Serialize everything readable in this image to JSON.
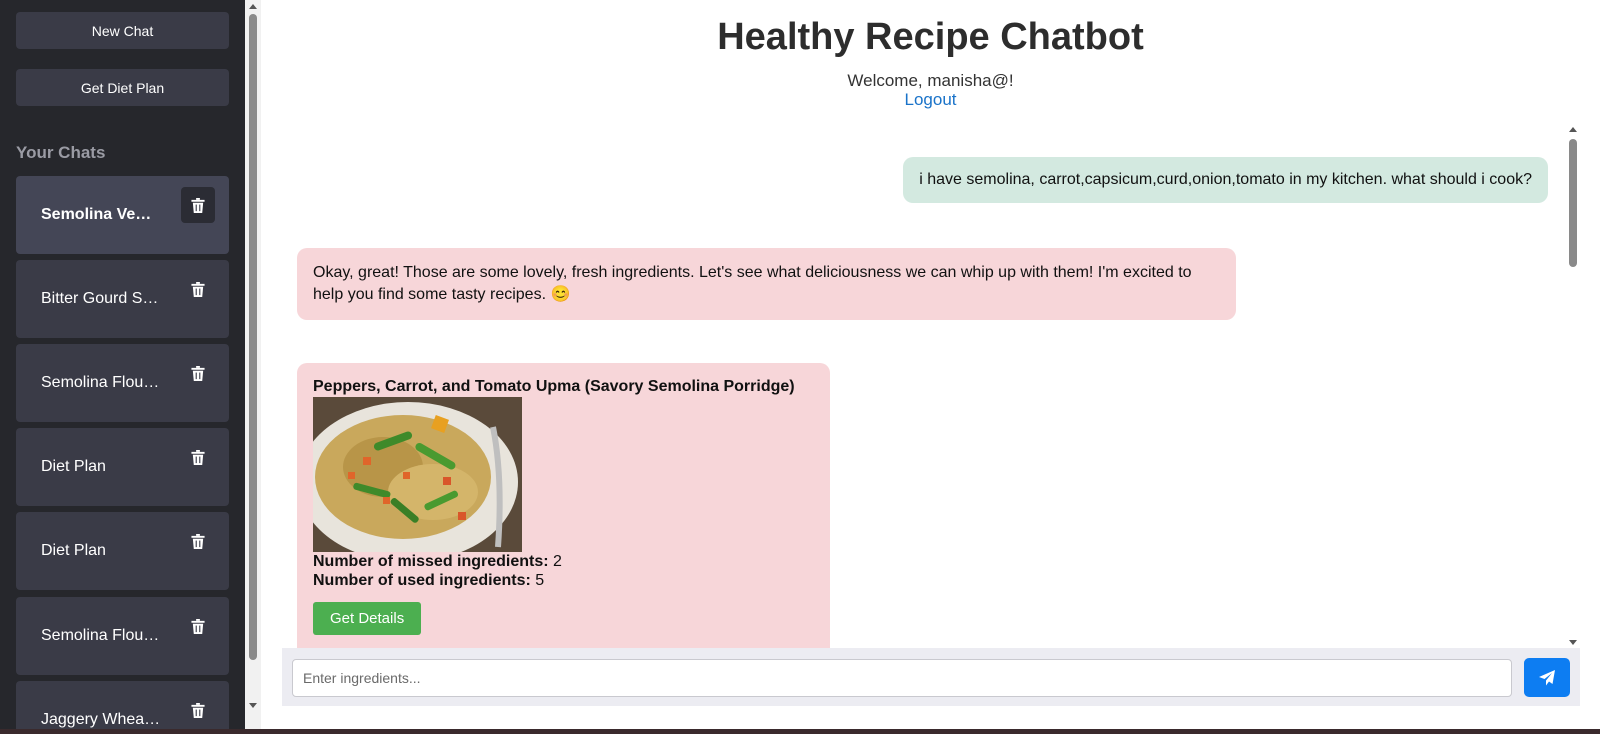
{
  "sidebar": {
    "new_chat_label": "New Chat",
    "diet_plan_label": "Get Diet Plan",
    "heading": "Your Chats",
    "chats": [
      {
        "label": "Semolina Veggie Upma",
        "active": true
      },
      {
        "label": "Bitter Gourd Stir Fry"
      },
      {
        "label": "Semolina Flour Recipes"
      },
      {
        "label": "Diet Plan"
      },
      {
        "label": "Diet Plan"
      },
      {
        "label": "Semolina Flour Recipes"
      },
      {
        "label": "Jaggery Wheat Recipes"
      }
    ]
  },
  "header": {
    "title": "Healthy Recipe Chatbot",
    "welcome": "Welcome, manisha@!",
    "logout": "Logout"
  },
  "messages": {
    "user": "i have semolina, carrot,capsicum,curd,onion,tomato in my kitchen. what should i cook?",
    "bot": "Okay, great! Those are some lovely, fresh ingredients. Let's see what deliciousness we can whip up with them! I'm excited to help you find some tasty recipes. 😊"
  },
  "recipe": {
    "title": "Peppers, Carrot, and Tomato Upma (Savory Semolina Porridge)",
    "missed_label": "Number of missed ingredients:",
    "missed_value": "2",
    "used_label": "Number of used ingredients:",
    "used_value": "5",
    "button": "Get Details"
  },
  "input": {
    "placeholder": "Enter ingredients...",
    "value": ""
  },
  "colors": {
    "sidebar_bg": "#26272c",
    "user_bubble": "#d3e9e0",
    "bot_bubble": "#f7d6d9",
    "send_button": "#0d7df2",
    "details_button": "#4caf50"
  }
}
